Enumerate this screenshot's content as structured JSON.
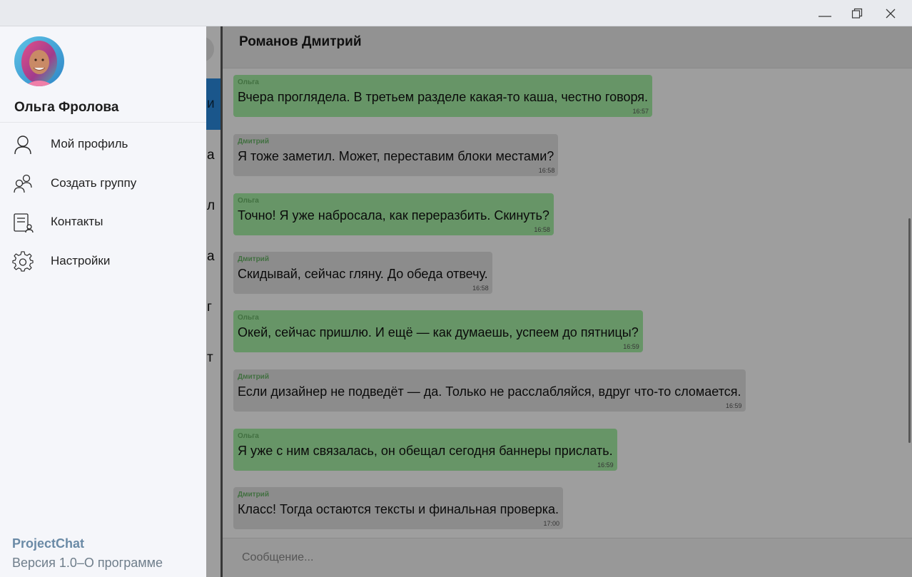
{
  "window": {
    "controls": [
      {
        "name": "minimize-icon"
      },
      {
        "name": "restore-icon"
      },
      {
        "name": "close-icon"
      }
    ]
  },
  "chat_list": {
    "visible_letters": [
      "и",
      "а",
      "л",
      "а",
      "г",
      "т"
    ]
  },
  "chat": {
    "title": "Романов Дмитрий",
    "messages": [
      {
        "author": "Ольга",
        "text": "Вчера проглядела. В третьем разделе какая-то каша, честно говоря.",
        "time": "16:57",
        "mine": true
      },
      {
        "author": "Дмитрий",
        "text": "Я тоже заметил. Может, переставим блоки местами?",
        "time": "16:58",
        "mine": false
      },
      {
        "author": "Ольга",
        "text": "Точно! Я уже набросала, как переразбить. Скинуть?",
        "time": "16:58",
        "mine": true
      },
      {
        "author": "Дмитрий",
        "text": "Скидывай, сейчас гляну. До обеда отвечу.",
        "time": "16:58",
        "mine": false
      },
      {
        "author": "Ольга",
        "text": "Окей, сейчас пришлю. И ещё — как думаешь, успеем до пятницы?",
        "time": "16:59",
        "mine": true
      },
      {
        "author": "Дмитрий",
        "text": "Если дизайнер не подведёт — да. Только не расслабляйся, вдруг что-то сломается.",
        "time": "16:59",
        "mine": false
      },
      {
        "author": "Ольга",
        "text": "Я уже с ним связалась, он обещал сегодня баннеры прислать.",
        "time": "16:59",
        "mine": true
      },
      {
        "author": "Дмитрий",
        "text": "Класс! Тогда остаются тексты и финальная проверка.",
        "time": "17:00",
        "mine": false
      }
    ],
    "composer_placeholder": "Сообщение..."
  },
  "drawer": {
    "user_name": "Ольга Фролова",
    "menu": [
      {
        "label": "Мой профиль",
        "icon": "user-icon"
      },
      {
        "label": "Создать группу",
        "icon": "group-icon"
      },
      {
        "label": "Контакты",
        "icon": "contacts-icon"
      },
      {
        "label": "Настройки",
        "icon": "gear-icon"
      }
    ],
    "app_name": "ProjectChat",
    "version": "Версия 1.0",
    "separator": "–",
    "about": "О программе"
  },
  "colors": {
    "accent": "#2b8be0",
    "my_bubble": "#a7f1a6",
    "their_bubble": "#e2e2e2",
    "author_name": "#6bb56a",
    "app_name": "#6a8aa6"
  }
}
